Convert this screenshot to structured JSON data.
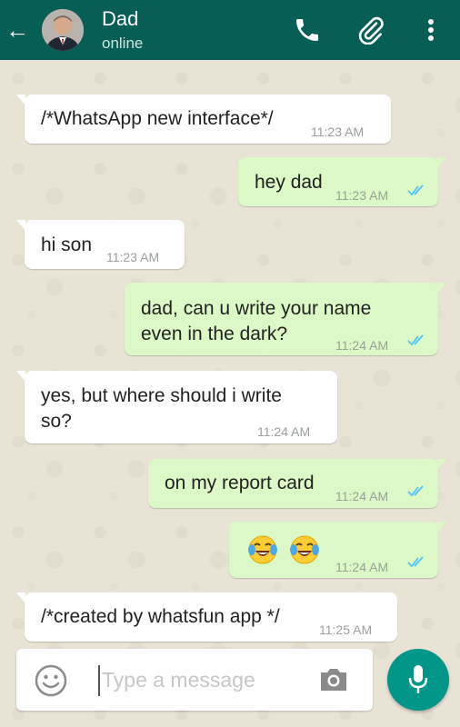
{
  "header": {
    "contact_name": "Dad",
    "status": "online",
    "back_icon": "arrow-left-icon",
    "call_icon": "phone-icon",
    "attach_icon": "paperclip-icon",
    "menu_icon": "more-vertical-icon",
    "bar_color": "#075e54"
  },
  "messages": [
    {
      "direction": "in",
      "text": "/*WhatsApp new interface*/",
      "time": "11:23 AM"
    },
    {
      "direction": "out",
      "text": "hey dad",
      "time": "11:23 AM",
      "read": true
    },
    {
      "direction": "in",
      "text": "hi son",
      "time": "11:23 AM"
    },
    {
      "direction": "out",
      "text": "dad, can u write your name\neven in the dark?",
      "time": "11:24 AM",
      "read": true
    },
    {
      "direction": "in",
      "text": "yes, but where should i write\nso?",
      "time": "11:24 AM"
    },
    {
      "direction": "out",
      "text": "on my report card",
      "time": "11:24 AM",
      "read": true
    },
    {
      "direction": "out",
      "text": "",
      "emoji": [
        "face-with-tears-of-joy",
        "face-with-tears-of-joy"
      ],
      "time": "11:24 AM",
      "read": true
    },
    {
      "direction": "in",
      "text": "/*created by whatsfun app */",
      "time": "11:25 AM"
    }
  ],
  "composer": {
    "placeholder": "Type a message",
    "emoji_icon": "smiley-icon",
    "camera_icon": "camera-icon",
    "mic_icon": "microphone-icon",
    "accent": "#009688"
  },
  "colors": {
    "incoming_bubble": "#ffffff",
    "outgoing_bubble": "#dcf8c6",
    "read_ticks": "#4fc3f7"
  }
}
